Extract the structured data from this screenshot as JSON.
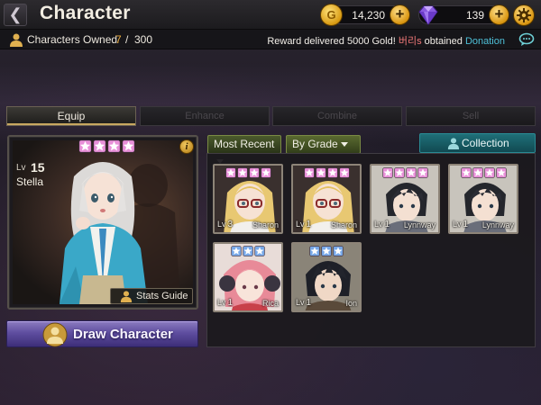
{
  "header": {
    "title": "Character",
    "back_glyph": "❮",
    "gold": "14,230",
    "gems": "139",
    "plus_glyph": "+",
    "gold_glyph": "G"
  },
  "owned": {
    "label": "Characters Owned",
    "count": "7",
    "separator": "/",
    "max": "300"
  },
  "ticker": {
    "prefix": "Reward delivered 5000 Gold!",
    "name": "버리s",
    "middle": "obtained",
    "action": "Donation"
  },
  "tabs": [
    {
      "label": "Equip",
      "active": true
    },
    {
      "label": "Enhance",
      "active": false
    },
    {
      "label": "Combine",
      "active": false
    },
    {
      "label": "Sell",
      "active": false
    }
  ],
  "selected": {
    "lv_label": "Lv",
    "level": "15",
    "name": "Stella",
    "stars": 4,
    "info_glyph": "i",
    "stats_guide": "Stats Guide"
  },
  "draw_button": "Draw Character",
  "filters": {
    "sort": "Most Recent",
    "grade": "By Grade",
    "collection": "Collection"
  },
  "roster": [
    {
      "name": "Sharon",
      "lv_label": "Lv",
      "level": "3",
      "stars": 4,
      "star_color": "#e890d8",
      "icon": "sharon-portrait-icon"
    },
    {
      "name": "Sharon",
      "lv_label": "Lv",
      "level": "1",
      "stars": 4,
      "star_color": "#e890d8",
      "icon": "sharon-portrait-icon"
    },
    {
      "name": "Lynnway",
      "lv_label": "Lv",
      "level": "1",
      "stars": 4,
      "star_color": "#e890d8",
      "icon": "lynnway-portrait-icon"
    },
    {
      "name": "Lynnway",
      "lv_label": "Lv",
      "level": "1",
      "stars": 4,
      "star_color": "#e890d8",
      "icon": "lynnway-portrait-icon"
    },
    {
      "name": "Rica",
      "lv_label": "Lv",
      "level": "1",
      "stars": 3,
      "star_color": "#78a8e8",
      "icon": "rica-portrait-icon"
    },
    {
      "name": "Ion",
      "lv_label": "Lv",
      "level": "1",
      "stars": 3,
      "star_color": "#78a8e8",
      "icon": "ion-portrait-icon"
    }
  ],
  "colors": {
    "accent_gold": "#f0b040",
    "ticker_name": "#f07878",
    "ticker_action": "#4ec0d8",
    "four_star": "#e890d8",
    "three_star": "#78a8e8"
  }
}
